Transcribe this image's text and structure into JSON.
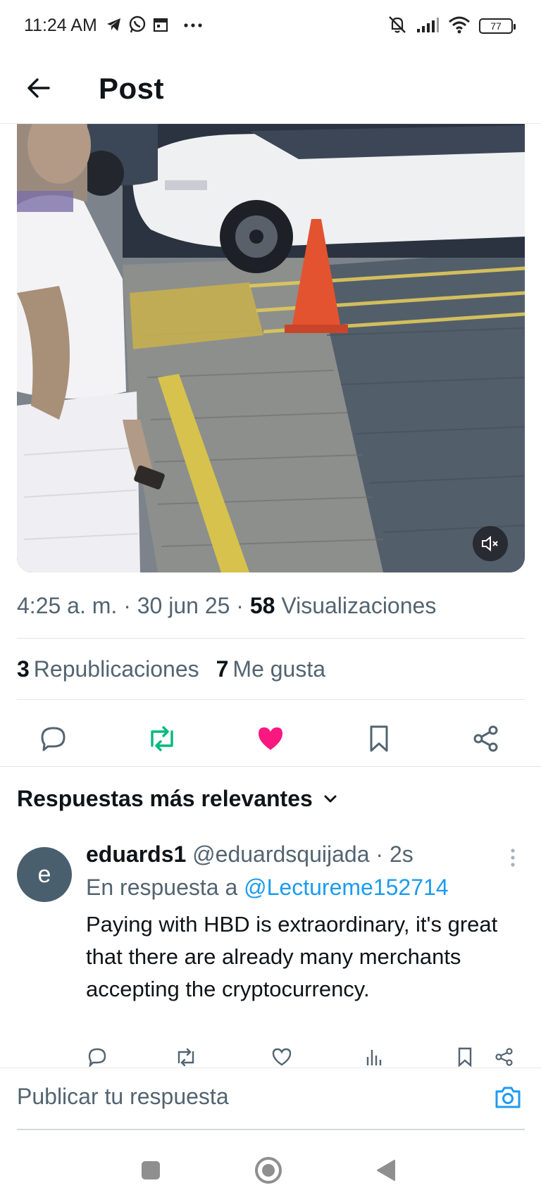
{
  "status_bar": {
    "time": "11:24 AM",
    "battery": "77",
    "icons_left": [
      "telegram-icon",
      "whatsapp-icon",
      "calendar-icon",
      "more-dots-icon"
    ],
    "icons_right": [
      "mute-bell-icon",
      "signal-icon",
      "wifi-icon",
      "battery-icon"
    ]
  },
  "header": {
    "title": "Post"
  },
  "post": {
    "media_description_icon": "video",
    "time": "4:25 a. m.",
    "date": "30 jun 25",
    "views_count": "58",
    "views_label": "Visualizaciones",
    "reposts_count": "3",
    "reposts_label": "Republicaciones",
    "likes_count": "7",
    "likes_label": "Me gusta",
    "separator": "·"
  },
  "colors": {
    "accent_blue": "#1d9bf0",
    "repost_green": "#00ba7c",
    "like_pink": "#f91880",
    "muted_text": "#536471"
  },
  "replies": {
    "sort_label": "Respuestas más relevantes",
    "items": [
      {
        "avatar_letter": "e",
        "name": "eduards1",
        "handle": "@eduardsquijada",
        "age": "2s",
        "reply_to_prefix": "En respuesta a",
        "reply_to_handle": "@Lectureme152714",
        "text": "Paying with HBD is extraordinary, it's great that there are already many merchants accepting the cryptocurrency."
      }
    ]
  },
  "compose": {
    "placeholder": "Publicar tu respuesta"
  }
}
